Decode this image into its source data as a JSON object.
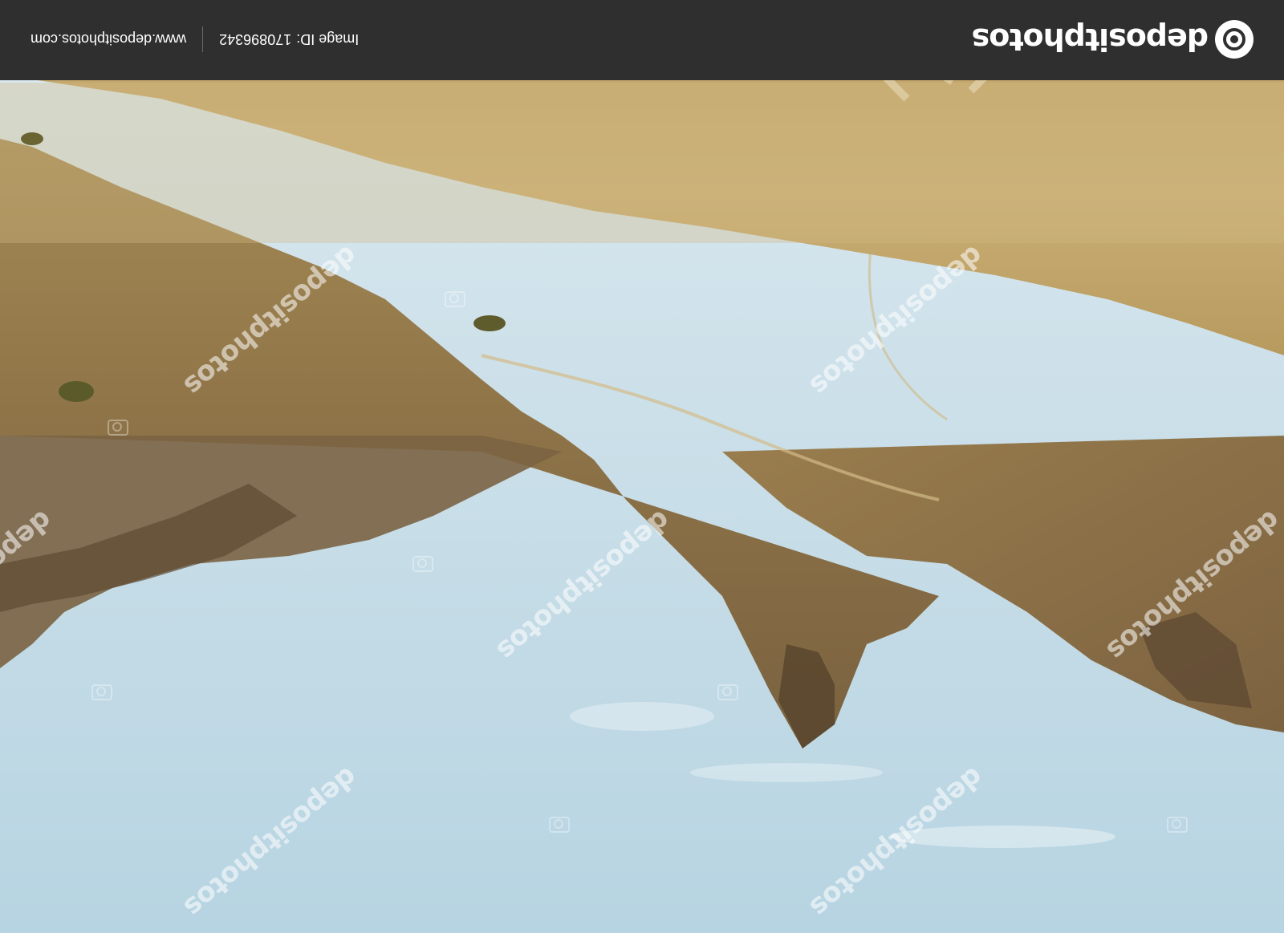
{
  "brand": {
    "logo_text": "depositphotos",
    "logo_icon": "camera-aperture-icon",
    "watermark_text": "depositphotos"
  },
  "footer": {
    "image_id_label": "Image ID:",
    "image_id_value": "170896342",
    "site_url": "www.depositphotos.com"
  },
  "colors": {
    "footer_bg": "#2f2f2f",
    "sky": "#c4dde8",
    "grass": "#c9ad72",
    "slope": "#8a6e44"
  }
}
